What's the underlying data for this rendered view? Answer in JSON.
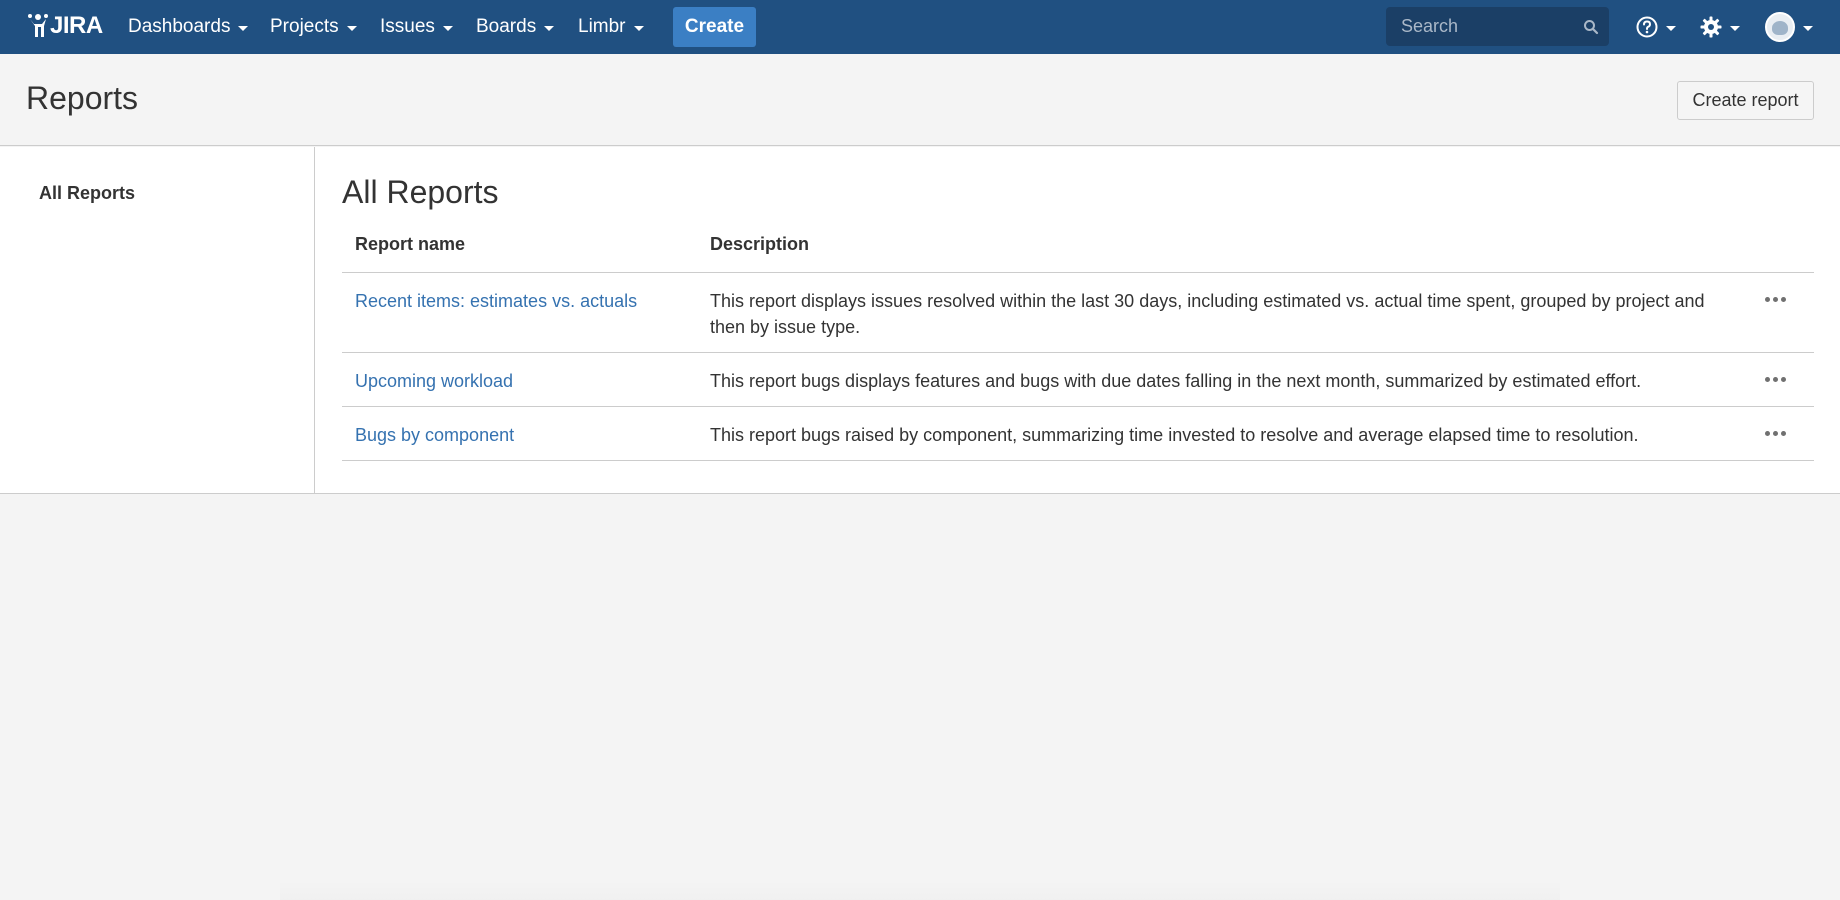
{
  "nav": {
    "logo_text": "JIRA",
    "items": [
      {
        "label": "Dashboards"
      },
      {
        "label": "Projects"
      },
      {
        "label": "Issues"
      },
      {
        "label": "Boards"
      },
      {
        "label": "Limbr"
      }
    ],
    "create_label": "Create",
    "search_placeholder": "Search",
    "colors": {
      "bar": "#205081",
      "create": "#3b7fc4",
      "search_bg": "#1b3f66"
    }
  },
  "header": {
    "title": "Reports",
    "create_report_label": "Create report"
  },
  "sidebar": {
    "items": [
      {
        "label": "All Reports"
      }
    ]
  },
  "main": {
    "title": "All Reports",
    "columns": [
      "Report name",
      "Description"
    ],
    "rows": [
      {
        "name": "Recent items: estimates vs. actuals",
        "description": "This report displays issues resolved within the last 30 days, including estimated vs. actual time spent, grouped by project and then by issue type."
      },
      {
        "name": "Upcoming workload",
        "description": "This report bugs displays features and bugs with due dates falling in the next month, summarized by estimated effort."
      },
      {
        "name": "Bugs by component",
        "description": "This report bugs raised by component, summarizing time invested to resolve and average elapsed time to resolution."
      }
    ],
    "link_color": "#3572b0"
  }
}
